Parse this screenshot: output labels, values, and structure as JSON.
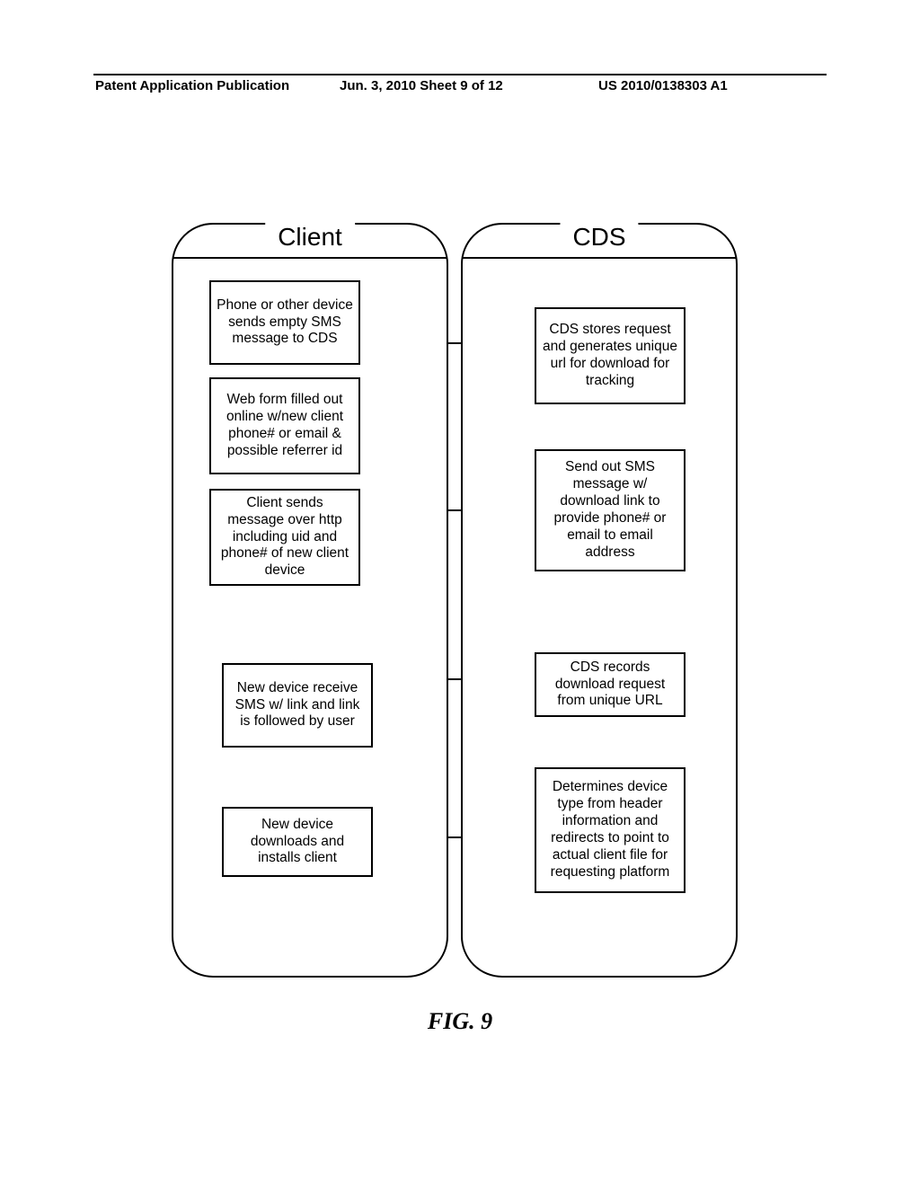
{
  "header": {
    "left": "Patent Application Publication",
    "center": "Jun. 3, 2010  Sheet 9 of 12",
    "right": "US 2010/0138303 A1"
  },
  "columns": {
    "left_title": "Client",
    "right_title": "CDS"
  },
  "client_boxes": {
    "b1": "Phone or other device sends empty SMS message to CDS",
    "b2": "Web form filled out online w/new client phone# or email & possible referrer id",
    "b3": "Client sends message over http including uid and phone# of new client device",
    "b4": "New device receive SMS w/ link and link is followed by user",
    "b5": "New device downloads and installs client"
  },
  "cds_boxes": {
    "c1": "CDS stores request and generates unique url for download for tracking",
    "c2": "Send out SMS message w/ download link to provide phone# or email to email address",
    "c3": "CDS records download request from unique URL",
    "c4": "Determines device type from header information and redirects to point to actual client file for requesting platform"
  },
  "figure_caption": "FIG.  9"
}
